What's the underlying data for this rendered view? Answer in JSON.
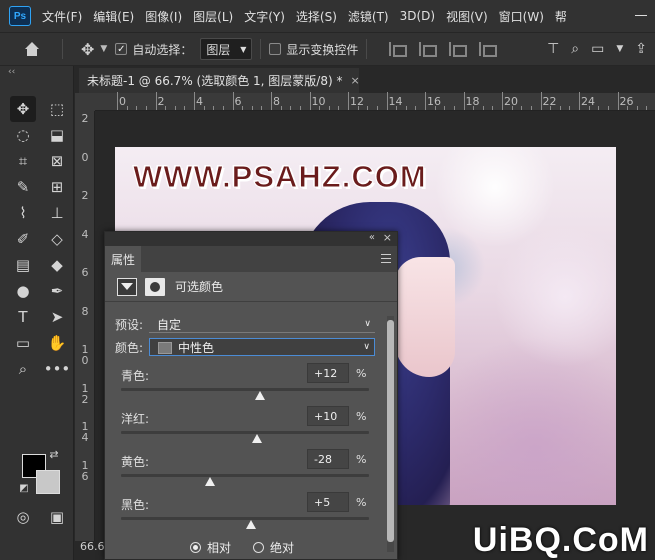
{
  "app": {
    "logo_text": "Ps",
    "menus": [
      "文件(F)",
      "编辑(E)",
      "图像(I)",
      "图层(L)",
      "文字(Y)",
      "选择(S)",
      "滤镜(T)",
      "3D(D)",
      "视图(V)",
      "窗口(W)",
      "帮"
    ]
  },
  "options": {
    "auto_select_label": "自动选择：",
    "auto_select_checked": true,
    "layer_mode": "图层",
    "show_transform_label": "显示变换控件",
    "show_transform_checked": false
  },
  "toolbar": {
    "collapse_glyph": "‹‹"
  },
  "document": {
    "tab_title": "未标题-1 @ 66.7% (选取颜色 1, 图层蒙版/8) *",
    "close_glyph": "×",
    "zoom": "66.6",
    "watermark": "WWW.PSAHZ.COM"
  },
  "ruler": {
    "top_labels": [
      "0",
      "2",
      "4",
      "6",
      "8",
      "10",
      "12",
      "14",
      "16",
      "18",
      "20",
      "22",
      "24",
      "26"
    ],
    "left_labels": [
      "2",
      "0",
      "2",
      "4",
      "6",
      "8",
      "1\n0",
      "1\n2",
      "1\n4",
      "1\n6"
    ]
  },
  "panel": {
    "title": "属性",
    "adjustment_title": "可选颜色",
    "preset_label": "预设:",
    "preset_value": "自定",
    "colors_label": "颜色:",
    "colors_value": "中性色",
    "sliders": [
      {
        "label": "青色:",
        "value": "+12",
        "unit": "%",
        "position": 0.56
      },
      {
        "label": "洋红:",
        "value": "+10",
        "unit": "%",
        "position": 0.55
      },
      {
        "label": "黄色:",
        "value": "-28",
        "unit": "%",
        "position": 0.36
      },
      {
        "label": "黑色:",
        "value": "+5",
        "unit": "%",
        "position": 0.525
      }
    ],
    "method_relative": "相对",
    "method_absolute": "绝对",
    "method_selected": "relative"
  },
  "site_mark": "UiBQ.CoM"
}
